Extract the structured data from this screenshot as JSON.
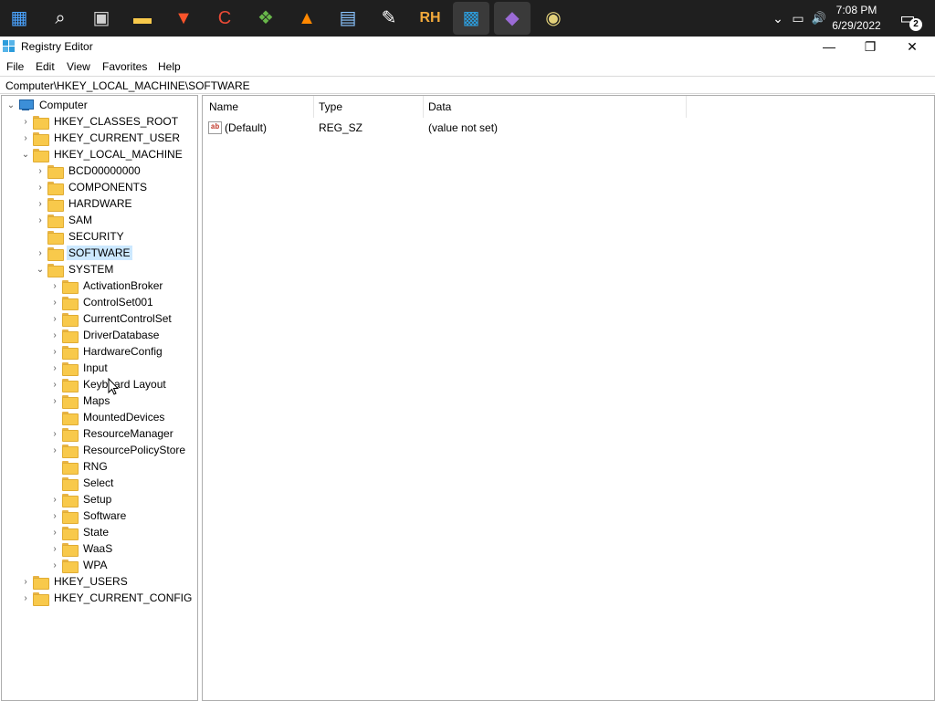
{
  "taskbar": {
    "icons": [
      {
        "name": "start-icon",
        "glyph": "▦",
        "color": "#4aa3ff"
      },
      {
        "name": "search-icon",
        "glyph": "⌕",
        "color": "#ffffff"
      },
      {
        "name": "task-view-icon",
        "glyph": "▣",
        "color": "#d0d0d0"
      },
      {
        "name": "file-explorer-icon",
        "glyph": "▬",
        "color": "#f8c94b"
      },
      {
        "name": "brave-browser-icon",
        "glyph": "▼",
        "color": "#fb542b"
      },
      {
        "name": "ccleaner-icon",
        "glyph": "C",
        "color": "#e84a36"
      },
      {
        "name": "windows-update-icon",
        "glyph": "❖",
        "color": "#68b74a"
      },
      {
        "name": "vlc-icon",
        "glyph": "▲",
        "color": "#ff8800"
      },
      {
        "name": "notepad-icon",
        "glyph": "▤",
        "color": "#8ac4ff"
      },
      {
        "name": "pen-tool-icon",
        "glyph": "✎",
        "color": "#ffffff"
      },
      {
        "name": "rh-icon",
        "glyph": "RH",
        "color": "#f2a93b"
      },
      {
        "name": "registry-editor-icon",
        "glyph": "▩",
        "color": "#2d9cdb"
      },
      {
        "name": "visual-studio-installer-icon",
        "glyph": "◆",
        "color": "#9b6bd6"
      },
      {
        "name": "disc-icon",
        "glyph": "◉",
        "color": "#e2d07a"
      }
    ],
    "tray": {
      "chevron": "⌄",
      "network": "▭",
      "volume": "🔊",
      "time": "7:08 PM",
      "date": "6/29/2022",
      "notification_count": "2"
    }
  },
  "window": {
    "title": "Registry Editor",
    "minimize": "—",
    "maximize": "❐",
    "close": "✕"
  },
  "menu": {
    "items": [
      "File",
      "Edit",
      "View",
      "Favorites",
      "Help"
    ]
  },
  "address": "Computer\\HKEY_LOCAL_MACHINE\\SOFTWARE",
  "tree": {
    "root": "Computer",
    "nodes": [
      {
        "label": "HKEY_CLASSES_ROOT",
        "level": 1,
        "expander": "›"
      },
      {
        "label": "HKEY_CURRENT_USER",
        "level": 1,
        "expander": "›"
      },
      {
        "label": "HKEY_LOCAL_MACHINE",
        "level": 1,
        "expander": "⌄"
      },
      {
        "label": "BCD00000000",
        "level": 2,
        "expander": "›"
      },
      {
        "label": "COMPONENTS",
        "level": 2,
        "expander": "›"
      },
      {
        "label": "HARDWARE",
        "level": 2,
        "expander": "›"
      },
      {
        "label": "SAM",
        "level": 2,
        "expander": "›"
      },
      {
        "label": "SECURITY",
        "level": 2,
        "expander": ""
      },
      {
        "label": "SOFTWARE",
        "level": 2,
        "expander": "›",
        "selected": true
      },
      {
        "label": "SYSTEM",
        "level": 2,
        "expander": "⌄"
      },
      {
        "label": "ActivationBroker",
        "level": 3,
        "expander": "›"
      },
      {
        "label": "ControlSet001",
        "level": 3,
        "expander": "›"
      },
      {
        "label": "CurrentControlSet",
        "level": 3,
        "expander": "›"
      },
      {
        "label": "DriverDatabase",
        "level": 3,
        "expander": "›"
      },
      {
        "label": "HardwareConfig",
        "level": 3,
        "expander": "›"
      },
      {
        "label": "Input",
        "level": 3,
        "expander": "›"
      },
      {
        "label": "Keyboard Layout",
        "level": 3,
        "expander": "›"
      },
      {
        "label": "Maps",
        "level": 3,
        "expander": "›"
      },
      {
        "label": "MountedDevices",
        "level": 3,
        "expander": ""
      },
      {
        "label": "ResourceManager",
        "level": 3,
        "expander": "›"
      },
      {
        "label": "ResourcePolicyStore",
        "level": 3,
        "expander": "›"
      },
      {
        "label": "RNG",
        "level": 3,
        "expander": ""
      },
      {
        "label": "Select",
        "level": 3,
        "expander": ""
      },
      {
        "label": "Setup",
        "level": 3,
        "expander": "›"
      },
      {
        "label": "Software",
        "level": 3,
        "expander": "›"
      },
      {
        "label": "State",
        "level": 3,
        "expander": "›"
      },
      {
        "label": "WaaS",
        "level": 3,
        "expander": "›"
      },
      {
        "label": "WPA",
        "level": 3,
        "expander": "›"
      },
      {
        "label": "HKEY_USERS",
        "level": 1,
        "expander": "›"
      },
      {
        "label": "HKEY_CURRENT_CONFIG",
        "level": 1,
        "expander": "›"
      }
    ]
  },
  "values_list": {
    "columns": [
      "Name",
      "Type",
      "Data"
    ],
    "rows": [
      {
        "icon": "ab",
        "name": "(Default)",
        "type": "REG_SZ",
        "data": "(value not set)"
      }
    ]
  }
}
